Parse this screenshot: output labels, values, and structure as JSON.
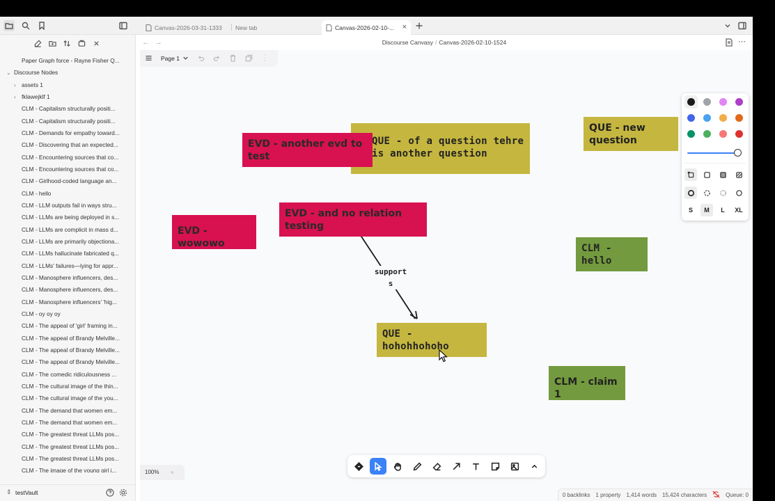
{
  "tabs": [
    {
      "label": "Canvas-2026-03-31-1333",
      "active": false
    },
    {
      "label": "New tab",
      "active": false
    },
    {
      "label": "Canvas-2026-02-10-...",
      "active": true
    }
  ],
  "breadcrumb": {
    "folder": "Discourse Canvasy",
    "separator": "/",
    "file": "Canvas-2026-02-10-1524"
  },
  "sidebar": {
    "items": [
      {
        "label": "Paper Graph force - Rayne Fisher Q...",
        "level": 1
      },
      {
        "label": "Discourse Nodes",
        "level": 0,
        "chevron": "open"
      },
      {
        "label": "assets 1",
        "level": 1,
        "chevron": "closed"
      },
      {
        "label": "fklawejklf 1",
        "level": 1,
        "chevron": "closed"
      },
      {
        "label": "CLM - Capitalism structurally positi...",
        "level": 1
      },
      {
        "label": "CLM - Capitalism structurally positi...",
        "level": 1
      },
      {
        "label": "CLM - Demands for empathy toward...",
        "level": 1
      },
      {
        "label": "CLM - Discovering that an expected...",
        "level": 1
      },
      {
        "label": "CLM - Encountering sources that co...",
        "level": 1
      },
      {
        "label": "CLM - Encountering sources that co...",
        "level": 1
      },
      {
        "label": "CLM - Girlhood-coded language an...",
        "level": 1
      },
      {
        "label": "CLM - hello",
        "level": 1
      },
      {
        "label": "CLM - LLM outputs fail in ways stru...",
        "level": 1
      },
      {
        "label": "CLM - LLMs are being deployed in s...",
        "level": 1
      },
      {
        "label": "CLM - LLMs are complicit in mass d...",
        "level": 1
      },
      {
        "label": "CLM - LLMs are primarily objectiona...",
        "level": 1
      },
      {
        "label": "CLM - LLMs hallucinate fabricated q...",
        "level": 1
      },
      {
        "label": "CLM - LLMs' failures—lying for appr...",
        "level": 1
      },
      {
        "label": "CLM - Manosphere influencers, des...",
        "level": 1
      },
      {
        "label": "CLM - Manosphere influencers, des...",
        "level": 1
      },
      {
        "label": "CLM - Manosphere influencers' 'hig...",
        "level": 1
      },
      {
        "label": "CLM - oy oy oy",
        "level": 1
      },
      {
        "label": "CLM - The appeal of 'girl' framing in...",
        "level": 1
      },
      {
        "label": "CLM - The appeal of Brandy Melville...",
        "level": 1
      },
      {
        "label": "CLM - The appeal of Brandy Melville...",
        "level": 1
      },
      {
        "label": "CLM - The appeal of Brandy Melville...",
        "level": 1
      },
      {
        "label": "CLM - The comedic ridiculousness ...",
        "level": 1
      },
      {
        "label": "CLM - The cultural image of the thin...",
        "level": 1
      },
      {
        "label": "CLM - The cultural image of the you...",
        "level": 1
      },
      {
        "label": "CLM - The demand that women em...",
        "level": 1
      },
      {
        "label": "CLM - The demand that women em...",
        "level": 1
      },
      {
        "label": "CLM - The greatest threat LLMs pos...",
        "level": 1
      },
      {
        "label": "CLM - The greatest threat LLMs pos...",
        "level": 1
      },
      {
        "label": "CLM - The greatest threat LLMs pos...",
        "level": 1
      },
      {
        "label": "CLM - The image of the young girl i...",
        "level": 1
      }
    ],
    "vault": "testVault"
  },
  "pagebar": {
    "page": "Page 1"
  },
  "nodes": [
    {
      "id": "que-question",
      "type": "que",
      "text": "QUE - of a question tehre is another question"
    },
    {
      "id": "evd-another",
      "type": "evd",
      "text": "EVD - another evd to test"
    },
    {
      "id": "que-new",
      "type": "que",
      "text": "QUE - new question"
    },
    {
      "id": "evd-norelation",
      "type": "evd",
      "text": "EVD - and no relation testing"
    },
    {
      "id": "evd-wowowo",
      "type": "evd",
      "text": "EVD - wowowo"
    },
    {
      "id": "clm-hello",
      "type": "clm",
      "text": "CLM - hello"
    },
    {
      "id": "que-hoho",
      "type": "que",
      "text": "QUE - hohohhohoho"
    },
    {
      "id": "clm-claim1",
      "type": "clm",
      "text": "CLM - claim 1"
    }
  ],
  "edge": {
    "label_line1": "support",
    "label_line2": "s"
  },
  "colors": {
    "evd": "#d81150",
    "que": "#c4b63f",
    "clm": "#739a3e",
    "accent": "#3b82f6"
  },
  "style_panel": {
    "colors": [
      "#1d1d1d",
      "#9fa4ab",
      "#e085f4",
      "#ae3ec9",
      "#4465e9",
      "#4ba1f1",
      "#f1ac4b",
      "#e16919",
      "#099268",
      "#4cb05e",
      "#f87777",
      "#e03131"
    ],
    "sizes": [
      "S",
      "M",
      "L",
      "XL"
    ],
    "selected_size": "M"
  },
  "zoom": {
    "level": "100%",
    "more": "»"
  },
  "statusbar": {
    "backlinks": "0 backlinks",
    "properties": "1 property",
    "words": "1,414 words",
    "characters": "15,424 characters",
    "queue": "Queue: 0"
  }
}
